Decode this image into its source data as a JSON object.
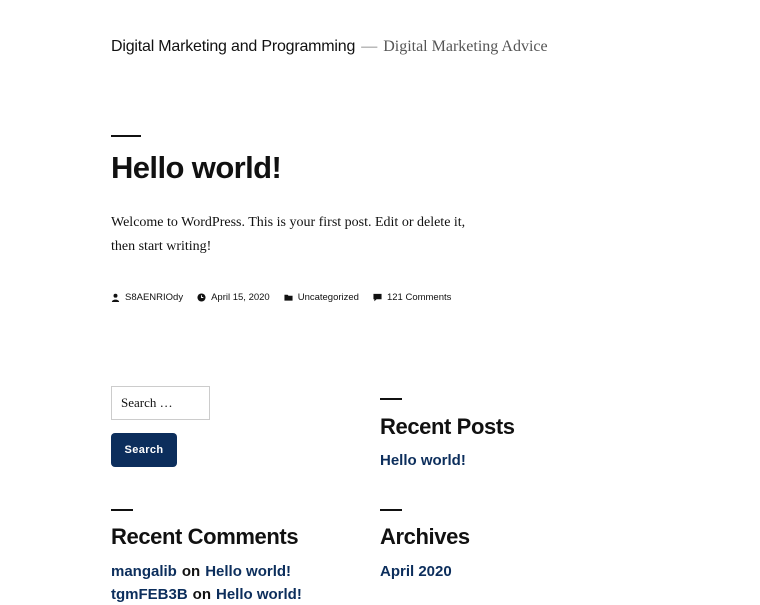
{
  "header": {
    "site_title": "Digital Marketing and Programming",
    "separator": "—",
    "site_description": "Digital Marketing Advice"
  },
  "post": {
    "title": "Hello world!",
    "content": "Welcome to WordPress. This is your first post. Edit or delete it, then start writing!",
    "meta": {
      "author": "S8AENRIOdy",
      "date": "April 15, 2020",
      "category": "Uncategorized",
      "comments": "121 Comments"
    }
  },
  "search": {
    "placeholder": "Search …",
    "button_label": "Search"
  },
  "recent_posts": {
    "title": "Recent Posts",
    "items": [
      "Hello world!"
    ]
  },
  "recent_comments": {
    "title": "Recent Comments",
    "on_word": "on",
    "items": [
      {
        "author": "mangalib",
        "post": "Hello world!"
      },
      {
        "author": "tgmFEB3B",
        "post": "Hello world!"
      }
    ]
  },
  "archives": {
    "title": "Archives",
    "items": [
      "April 2020"
    ]
  },
  "colors": {
    "text": "#111111",
    "link_accent": "#0c2e5c",
    "button_bg": "#0c2e5c",
    "separator": "#767676"
  },
  "icons": {
    "author": "person-icon",
    "date": "clock-icon",
    "category": "folder-icon",
    "comments": "comment-icon"
  }
}
